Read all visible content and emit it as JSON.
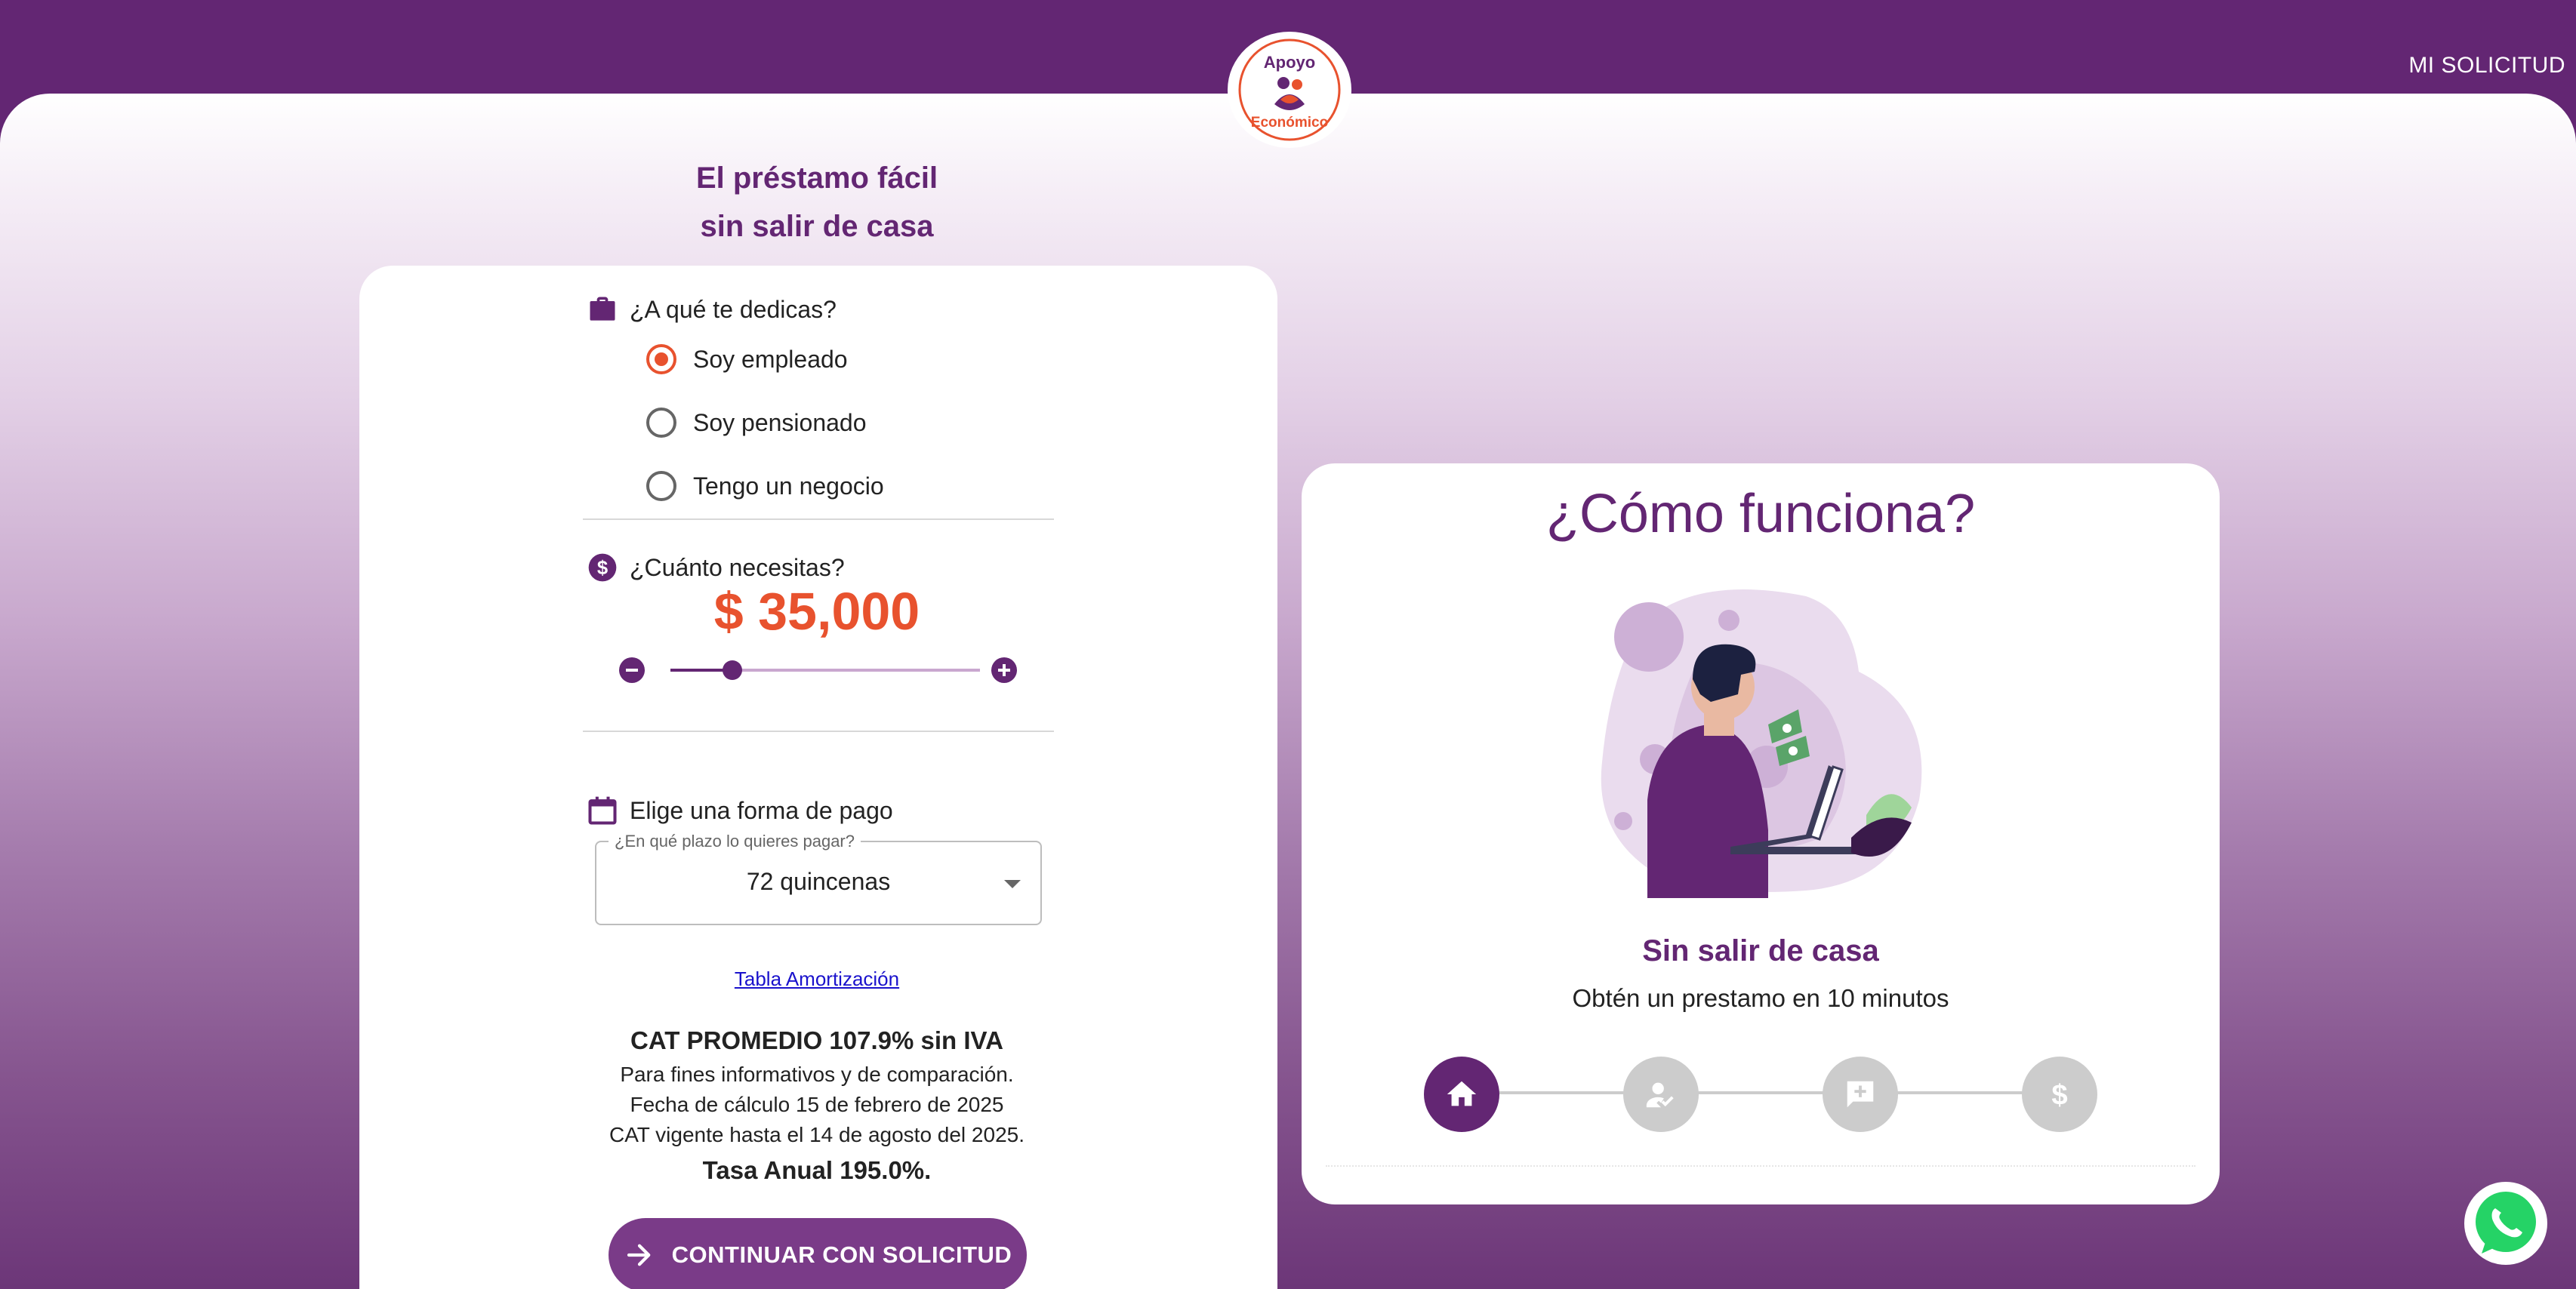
{
  "header": {
    "link_label": "MI SOLICITUD",
    "logo_text_top": "Apoyo",
    "logo_text_bottom": "Económico"
  },
  "hero": {
    "line1": "El préstamo fácil",
    "line2": "sin salir de casa"
  },
  "occupation": {
    "question": "¿A qué te dedicas?",
    "icon": "briefcase-icon",
    "options": [
      "Soy empleado",
      "Soy pensionado",
      "Tengo un negocio"
    ],
    "selected": "Soy empleado"
  },
  "amount": {
    "question": "¿Cuánto necesitas?",
    "icon": "dollar-circle-icon",
    "value": "$ 35,000",
    "slider_fraction": 0.2
  },
  "payment": {
    "label": "Elige una forma de pago",
    "icon": "calendar-icon",
    "select_legend": "¿En qué plazo lo quieres pagar?",
    "select_value": "72 quincenas"
  },
  "amortization_link": "Tabla Amortización",
  "cat": {
    "title": "CAT PROMEDIO 107.9% sin IVA",
    "line1": "Para fines informativos y de comparación.",
    "line2": "Fecha de cálculo 15 de febrero de 2025",
    "line3": "CAT vigente hasta el 14 de agosto del 2025.",
    "tasa": "Tasa Anual 195.0%."
  },
  "cta_label": "CONTINUAR CON SOLICITUD",
  "how": {
    "title": "¿Cómo funciona?",
    "subtitle": "Sin salir de casa",
    "description": "Obtén un prestamo en 10 minutos",
    "steps": [
      "home-icon",
      "user-check-icon",
      "add-comment-icon",
      "dollar-icon"
    ],
    "active_step": 0
  },
  "colors": {
    "brand_purple": "#632673",
    "accent_orange": "#e8522e",
    "cta_purple": "#7a3b88",
    "step_inactive": "#cccccc",
    "whatsapp_green": "#25d366"
  }
}
